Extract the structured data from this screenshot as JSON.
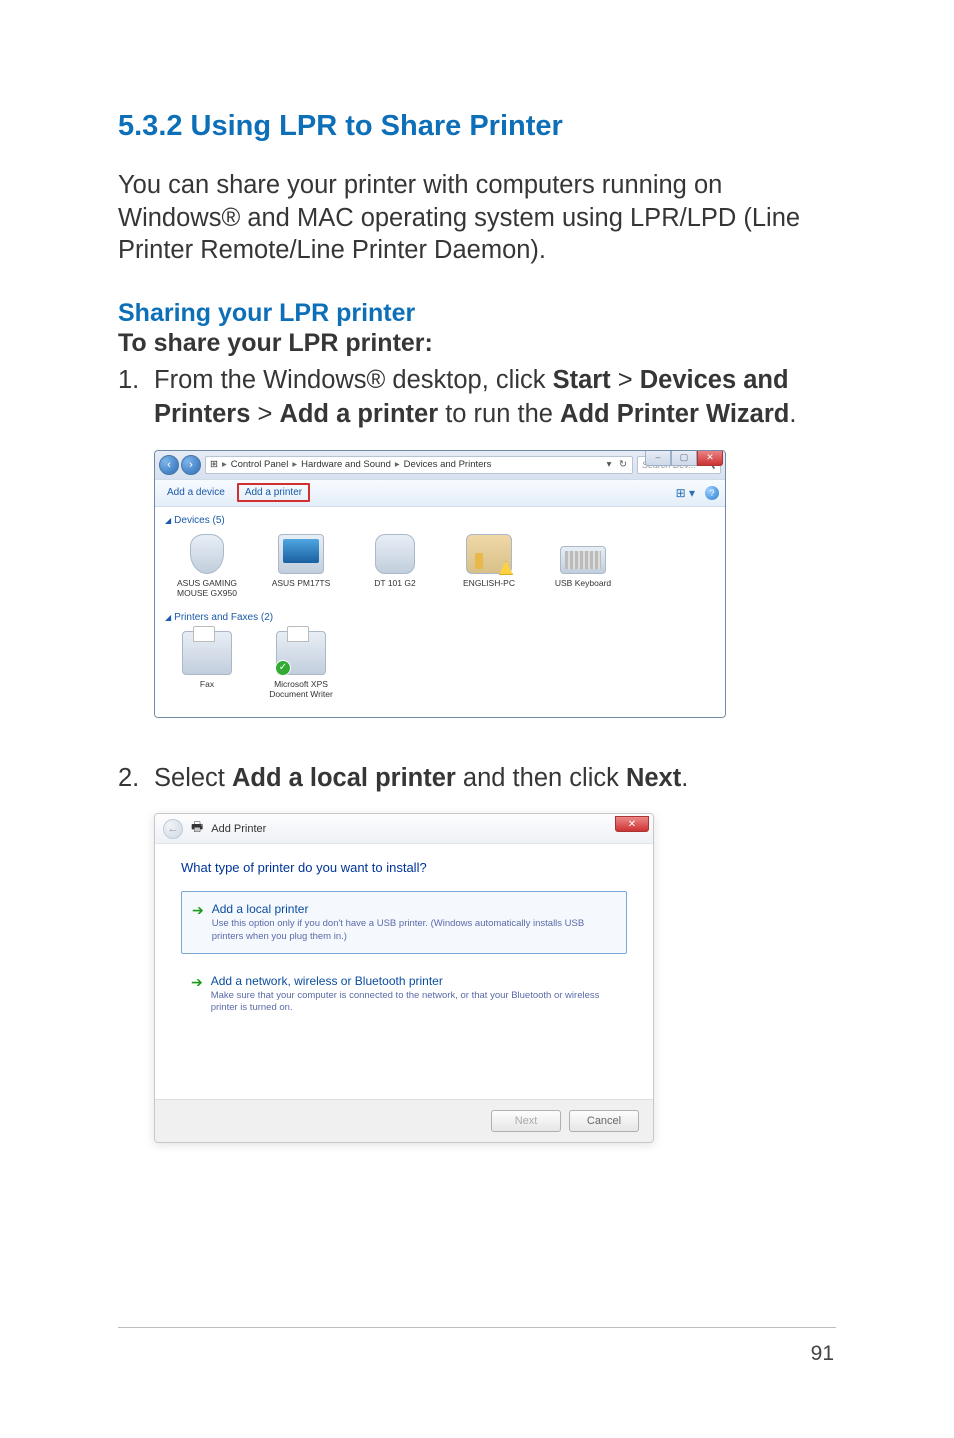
{
  "section_heading": "5.3.2 Using LPR to Share Printer",
  "intro": "You can share your printer with computers running on Windows® and MAC operating system using LPR/LPD (Line Printer Remote/Line Printer Daemon).",
  "sharing_heading": "Sharing your LPR printer",
  "to_share_heading": "To share your LPR printer:",
  "step1": {
    "num": "1.",
    "pre": "From the Windows® desktop, click ",
    "start": "Start",
    "gt1": " > ",
    "dev": "Devices and Printers",
    "gt2": " > ",
    "add": "Add a printer",
    "mid": " to run the ",
    "wiz": "Add Printer Wizard",
    "end": "."
  },
  "step2": {
    "num": "2.",
    "pre": "Select ",
    "opt": "Add a local printer",
    "mid": " and then click ",
    "next": "Next",
    "end": "."
  },
  "shot1": {
    "breadcrumb": {
      "a": "Control Panel",
      "b": "Hardware and Sound",
      "c": "Devices and Printers"
    },
    "search_placeholder": "Search Dev...",
    "cmd_add_device": "Add a device",
    "cmd_add_printer": "Add a printer",
    "group_devices": "Devices (5)",
    "group_printers": "Printers and Faxes (2)",
    "devices": [
      "ASUS GAMING MOUSE GX950",
      "ASUS PM17TS",
      "DT 101 G2",
      "ENGLISH-PC",
      "USB Keyboard"
    ],
    "printers": [
      "Fax",
      "Microsoft XPS Document Writer"
    ]
  },
  "shot2": {
    "title": "Add Printer",
    "heading": "What type of printer do you want to install?",
    "opt1": {
      "title": "Add a local printer",
      "desc": "Use this option only if you don't have a USB printer. (Windows automatically installs USB printers when you plug them in.)"
    },
    "opt2": {
      "title": "Add a network, wireless or Bluetooth printer",
      "desc": "Make sure that your computer is connected to the network, or that your Bluetooth or wireless printer is turned on."
    },
    "btn_next": "Next",
    "btn_cancel": "Cancel"
  },
  "page_number": "91"
}
